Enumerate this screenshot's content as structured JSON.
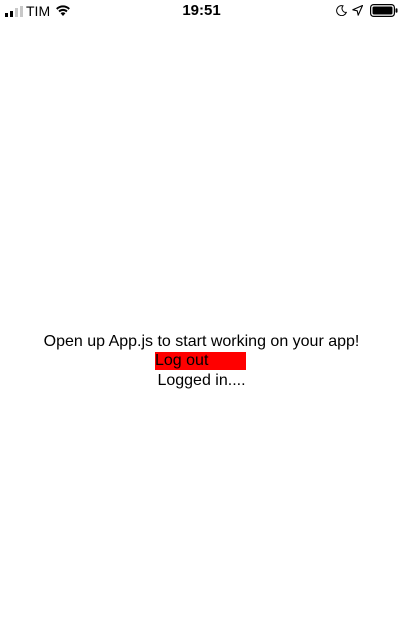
{
  "status_bar": {
    "carrier": "TIM",
    "time": "19:51",
    "icons": [
      "signal-icon",
      "wifi-icon",
      "moon-icon",
      "location-icon",
      "battery-icon"
    ]
  },
  "main": {
    "intro_text": "Open up App.js to start working on your app!",
    "logout_label": "Log out",
    "status_text": "Logged in...."
  },
  "colors": {
    "background": "#ffffff",
    "logout_background": "#ff0000",
    "text": "#000000"
  }
}
